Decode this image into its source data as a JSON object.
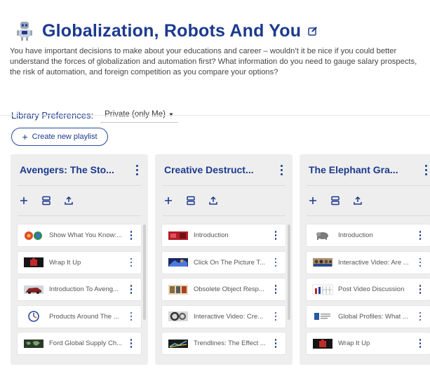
{
  "header": {
    "title": "Globalization, Robots And You",
    "description": "You have important decisions to make about your educations and career – wouldn’t it be nice if you could better understand the forces of globalization and automation first? What information do you need to gauge salary prospects, the risk of automation, and foreign competition as you compare your options?"
  },
  "preferences": {
    "label": "Library Preferences:",
    "selected": "Private (only Me)"
  },
  "create_button": {
    "label": "Create new playlist"
  },
  "playlists": [
    {
      "title": "Avengers: The Sto...",
      "items": [
        {
          "label": "Show What You Know:...",
          "thumb": "balls"
        },
        {
          "label": "Wrap It Up",
          "thumb": "dark-red"
        },
        {
          "label": "Introduction To Aveng...",
          "thumb": "car"
        },
        {
          "label": "Products Around The ...",
          "thumb": "dial"
        },
        {
          "label": "Ford Global Supply Ch...",
          "thumb": "map"
        }
      ]
    },
    {
      "title": "Creative Destruct...",
      "items": [
        {
          "label": "Introduction",
          "thumb": "red"
        },
        {
          "label": "Click On The Picture T...",
          "thumb": "blue"
        },
        {
          "label": "Obsolete Object Resp...",
          "thumb": "objects"
        },
        {
          "label": "Interactive Video: Cre...",
          "thumb": "gears"
        },
        {
          "label": "Trendlines: The Effect ...",
          "thumb": "graph"
        }
      ]
    },
    {
      "title": "The Elephant Gra...",
      "items": [
        {
          "label": "Introduction",
          "thumb": "elephant"
        },
        {
          "label": "Interactive Video: Are ...",
          "thumb": "crowd"
        },
        {
          "label": "Post Video Discussion",
          "thumb": "chart"
        },
        {
          "label": "Global Profiles: What ...",
          "thumb": "profile"
        },
        {
          "label": "Wrap It Up",
          "thumb": "dark-red"
        }
      ]
    }
  ],
  "colors": {
    "accent": "#1c3a8e",
    "column_bg": "#eeeeee"
  }
}
